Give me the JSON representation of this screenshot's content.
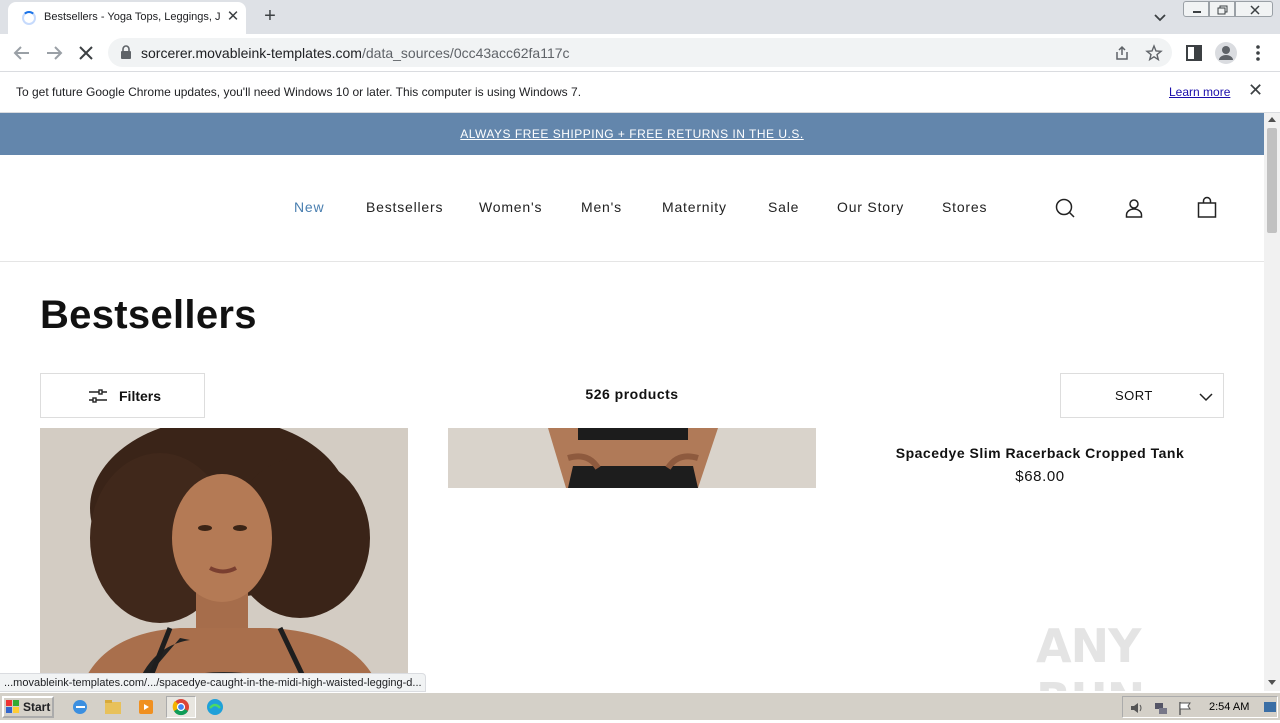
{
  "browser": {
    "tab_title": "Bestsellers - Yoga Tops, Leggings, Jumpsuits",
    "url_host": "sorcerer.movableink-templates.com",
    "url_path": "/data_sources/0cc43acc62fa117c",
    "infobar_text": "To get future Google Chrome updates, you'll need Windows 10 or later. This computer is using Windows 7.",
    "infobar_link": "Learn more",
    "status_url": "...movableink-templates.com/.../spacedye-caught-in-the-midi-high-waisted-legging-d..."
  },
  "site": {
    "promo": "ALWAYS FREE SHIPPING + FREE RETURNS IN THE U.S.",
    "nav": [
      "New",
      "Bestsellers",
      "Women's",
      "Men's",
      "Maternity",
      "Sale",
      "Our Story",
      "Stores"
    ],
    "page_title": "Bestsellers",
    "filters_label": "Filters",
    "product_count": "526 products",
    "sort_label": "SORT",
    "products": [
      {
        "name": "Spacedye Slim Racerback Cropped Tank",
        "price": "$68.00"
      }
    ]
  },
  "taskbar": {
    "start": "Start",
    "clock": "2:54 AM"
  },
  "watermark": "ANY RUN",
  "colors": {
    "promo_bg": "#6386ac",
    "nav_active": "#4a7fb0"
  }
}
